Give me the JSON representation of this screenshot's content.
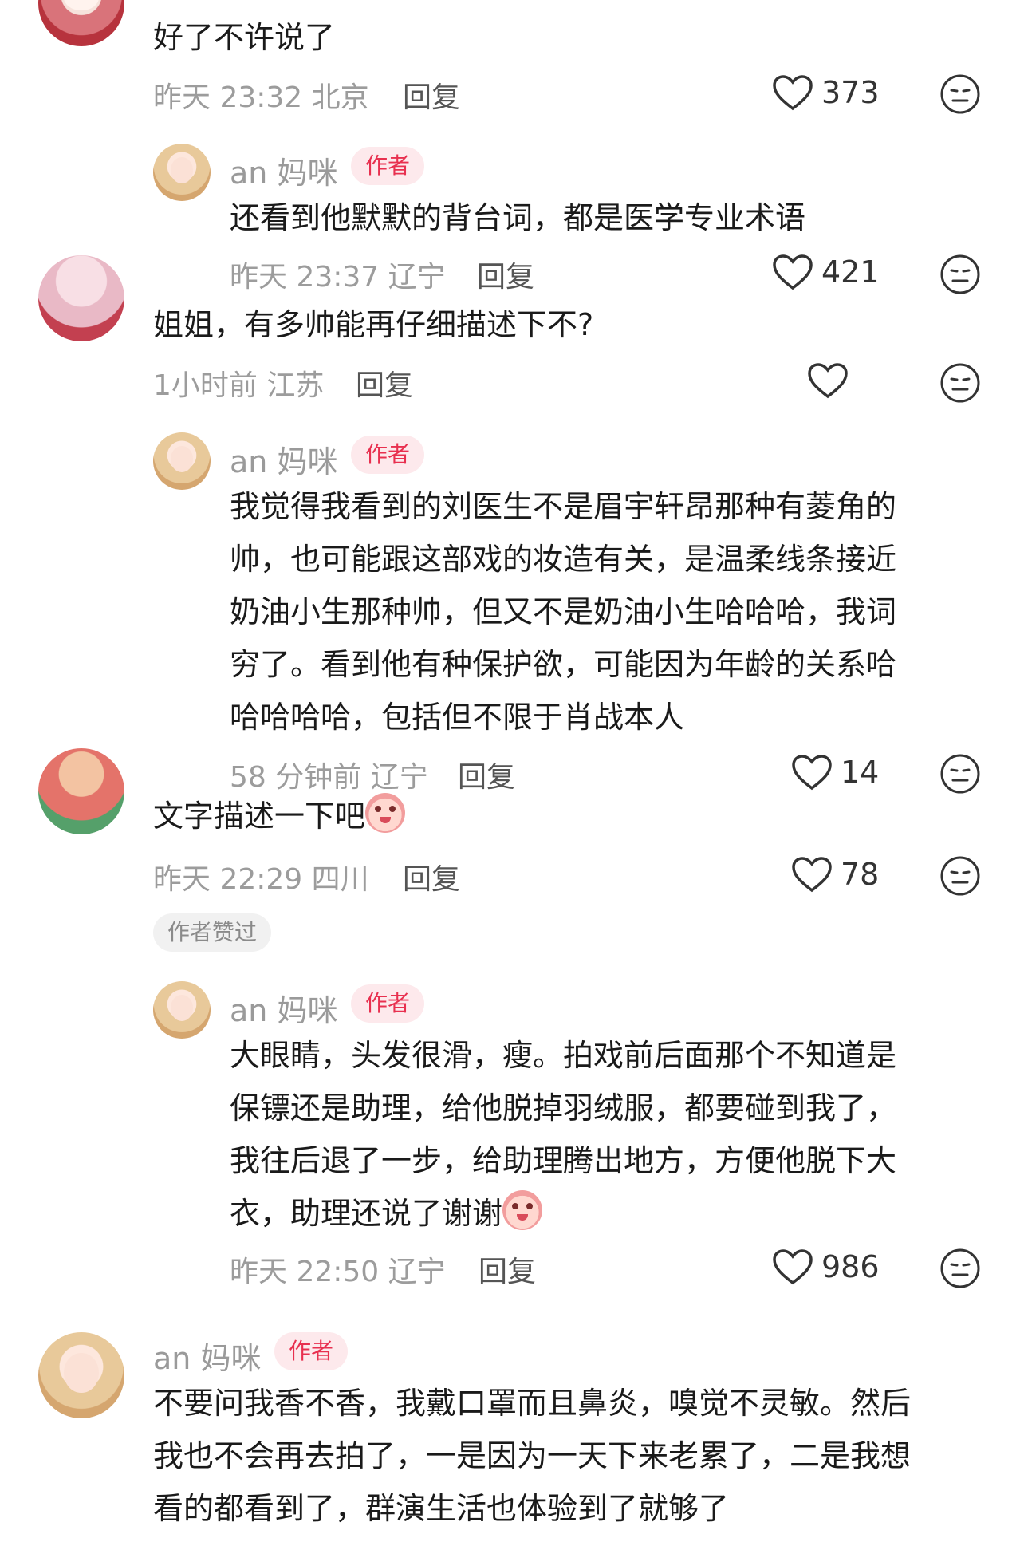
{
  "comments": [
    {
      "name": "",
      "text": "好了不许说了",
      "meta": "昨天 23:32 北京",
      "reply": "回复",
      "likes": "373"
    },
    {
      "name": "an 妈咪",
      "badge": "作者",
      "text": "还看到他默默的背台词，都是医学专业术语",
      "meta": "昨天 23:37 辽宁",
      "reply": "回复",
      "likes": "421"
    },
    {
      "name": "",
      "text": "姐姐，有多帅能再仔细描述下不?",
      "meta": "1小时前 江苏",
      "reply": "回复",
      "likes": ""
    },
    {
      "name": "an 妈咪",
      "badge": "作者",
      "lines": [
        "我觉得我看到的刘医生不是眉宇轩昂那种有菱角的",
        "帅，也可能跟这部戏的妆造有关，是温柔线条接近",
        "奶油小生那种帅，但又不是奶油小生哈哈哈，我词",
        "穷了。看到他有种保护欲，可能因为年龄的关系哈",
        "哈哈哈哈，包括但不限于肖战本人"
      ],
      "meta": "58 分钟前 辽宁",
      "reply": "回复",
      "likes": "14"
    },
    {
      "name": "",
      "text": "文字描述一下吧",
      "meta": "昨天 22:29 四川",
      "reply": "回复",
      "likes": "78",
      "tag": "作者赞过"
    },
    {
      "name": "an 妈咪",
      "badge": "作者",
      "lines": [
        "大眼睛，头发很滑，瘦。拍戏前后面那个不知道是",
        "保镖还是助理，给他脱掉羽绒服，都要碰到我了，",
        "我往后退了一步，给助理腾出地方，方便他脱下大",
        "衣，助理还说了谢谢"
      ],
      "meta": "昨天 22:50 辽宁",
      "reply": "回复",
      "likes": "986"
    },
    {
      "name": "an 妈咪",
      "badge": "作者",
      "lines": [
        "不要问我香不香，我戴口罩而且鼻炎，嗅觉不灵敏。然后",
        "我也不会再去拍了，一是因为一天下来老累了，二是我想",
        "看的都看到了，群演生活也体验到了就够了"
      ]
    }
  ],
  "colors": {
    "accent": "#e8304f",
    "badge_bg": "#fde9ec",
    "meta": "#9c9c9c"
  },
  "icons": {
    "like": "heart-outline-icon",
    "dislike": "neutral-face-icon"
  }
}
